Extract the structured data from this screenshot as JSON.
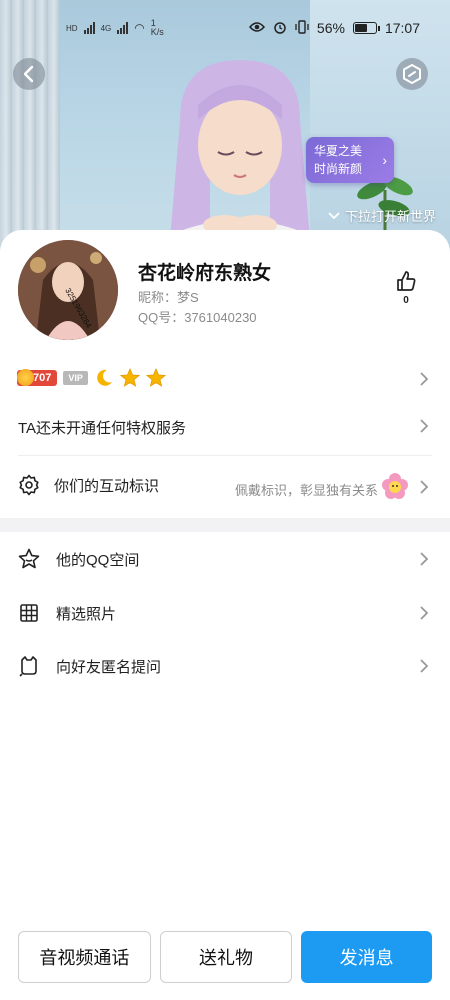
{
  "status_bar": {
    "network_speed": "1",
    "network_speed_unit": "K/s",
    "battery_percent": "56%",
    "battery_level": 0.56,
    "time": "17:07",
    "left_indicators": [
      "HD",
      "4G",
      "HD",
      "4G"
    ]
  },
  "banner": {
    "promo_line1": "华夏之美",
    "promo_line2": "时尚新颜",
    "pull_hint": "下拉打开新世界"
  },
  "profile": {
    "nickname": "杏花岭府东熟女",
    "alias_label": "昵称：梦S",
    "qq_label": "QQ号：3761040230",
    "likes": "0",
    "level": "707",
    "vip_label": "VIP",
    "avatar_overlay_text": "3251963284"
  },
  "privilege": {
    "text": "TA还未开通任何特权服务"
  },
  "interaction": {
    "label": "你们的互动标识",
    "hint": "佩戴标识，彰显独有关系"
  },
  "menu": [
    {
      "label": "他的QQ空间",
      "icon": "star-outline-icon"
    },
    {
      "label": "精选照片",
      "icon": "grid-icon"
    },
    {
      "label": "向好友匿名提问",
      "icon": "cat-bubble-icon"
    }
  ],
  "actions": {
    "call": "音视频通话",
    "gift": "送礼物",
    "message": "发消息"
  },
  "colors": {
    "primary": "#1d9bf3",
    "level_badge": "#e2483a",
    "promo": "#7b6ad6"
  }
}
